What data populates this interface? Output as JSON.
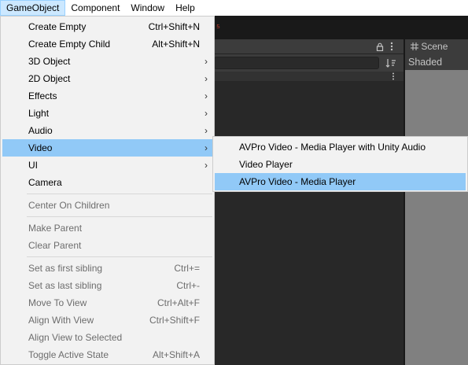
{
  "menubar": {
    "items": [
      "GameObject",
      "Component",
      "Window",
      "Help"
    ]
  },
  "editor": {
    "scene_tab": "Scene",
    "shading_mode": "Shaded",
    "icons": [
      "lock-icon",
      "kebab-menu-icon",
      "scene-grid-icon",
      "hierarchy-sort-icon"
    ]
  },
  "menu": {
    "items": [
      {
        "label": "Create Empty",
        "shortcut": "Ctrl+Shift+N"
      },
      {
        "label": "Create Empty Child",
        "shortcut": "Alt+Shift+N"
      },
      {
        "label": "3D Object"
      },
      {
        "label": "2D Object"
      },
      {
        "label": "Effects"
      },
      {
        "label": "Light"
      },
      {
        "label": "Audio"
      },
      {
        "label": "Video"
      },
      {
        "label": "UI"
      },
      {
        "label": "Camera"
      },
      {
        "label": "Center On Children"
      },
      {
        "label": "Make Parent"
      },
      {
        "label": "Clear Parent"
      },
      {
        "label": "Set as first sibling",
        "shortcut": "Ctrl+="
      },
      {
        "label": "Set as last sibling",
        "shortcut": "Ctrl+-"
      },
      {
        "label": "Move To View",
        "shortcut": "Ctrl+Alt+F"
      },
      {
        "label": "Align With View",
        "shortcut": "Ctrl+Shift+F"
      },
      {
        "label": "Align View to Selected"
      },
      {
        "label": "Toggle Active State",
        "shortcut": "Alt+Shift+A"
      }
    ],
    "submenu_arrow": "›"
  },
  "video_submenu": {
    "items": [
      {
        "label": "AVPro Video - Media Player with Unity Audio"
      },
      {
        "label": "Video Player"
      },
      {
        "label": "AVPro Video - Media Player"
      }
    ]
  }
}
